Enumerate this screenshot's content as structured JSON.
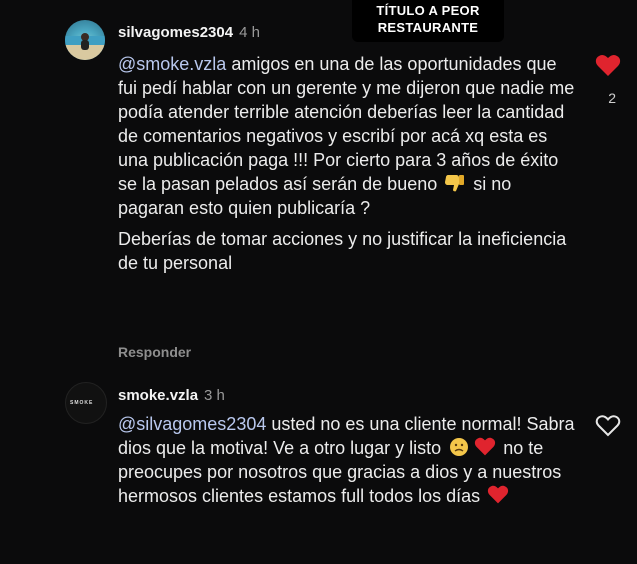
{
  "overlay": {
    "line1": "TÍTULO A PEOR",
    "line2": "RESTAURANTE"
  },
  "comments": [
    {
      "username": "silvagomes2304",
      "time": "4 h",
      "mention": "@smoke.vzla",
      "text_a": " amigos en una de las oportunidades que fui pedí hablar con un gerente y me dijeron que nadie me podía atender terrible atención deberías leer la cantidad de comentarios negativos y escribí por acá xq esta es una publicación paga !!! Por cierto para 3 años de éxito se la pasan pelados así serán de bueno ",
      "text_b": " si no pagaran esto quien publicaría ?",
      "paragraph2": "Deberías de tomar acciones y no justificar la ineficiencia de tu personal",
      "reply_label": "Responder",
      "like_count": "2",
      "liked": true,
      "icons": {
        "emoji": "thumbs-down-icon",
        "like": "heart-filled-icon"
      }
    },
    {
      "username": "smoke.vzla",
      "time": "3 h",
      "avatar_text": "SMOKE",
      "mention": "@silvagomes2304",
      "text_a": " usted no es una cliente normal! Sabra dios que la motiva! Ve a otro lugar y listo ",
      "text_b": " no te preocupes por nosotros que gracias a dios y a nuestros hermosos clientes estamos full todos los días ",
      "liked": false,
      "icons": {
        "emoji1": "sad-face-icon",
        "emoji2": "red-heart-icon",
        "emoji3": "red-heart-icon",
        "like": "heart-outline-icon"
      }
    }
  ],
  "colors": {
    "background": "#0b0b0c",
    "mention": "#b9c8ee",
    "heart": "#e0242e",
    "muted": "#8e8e8e"
  }
}
